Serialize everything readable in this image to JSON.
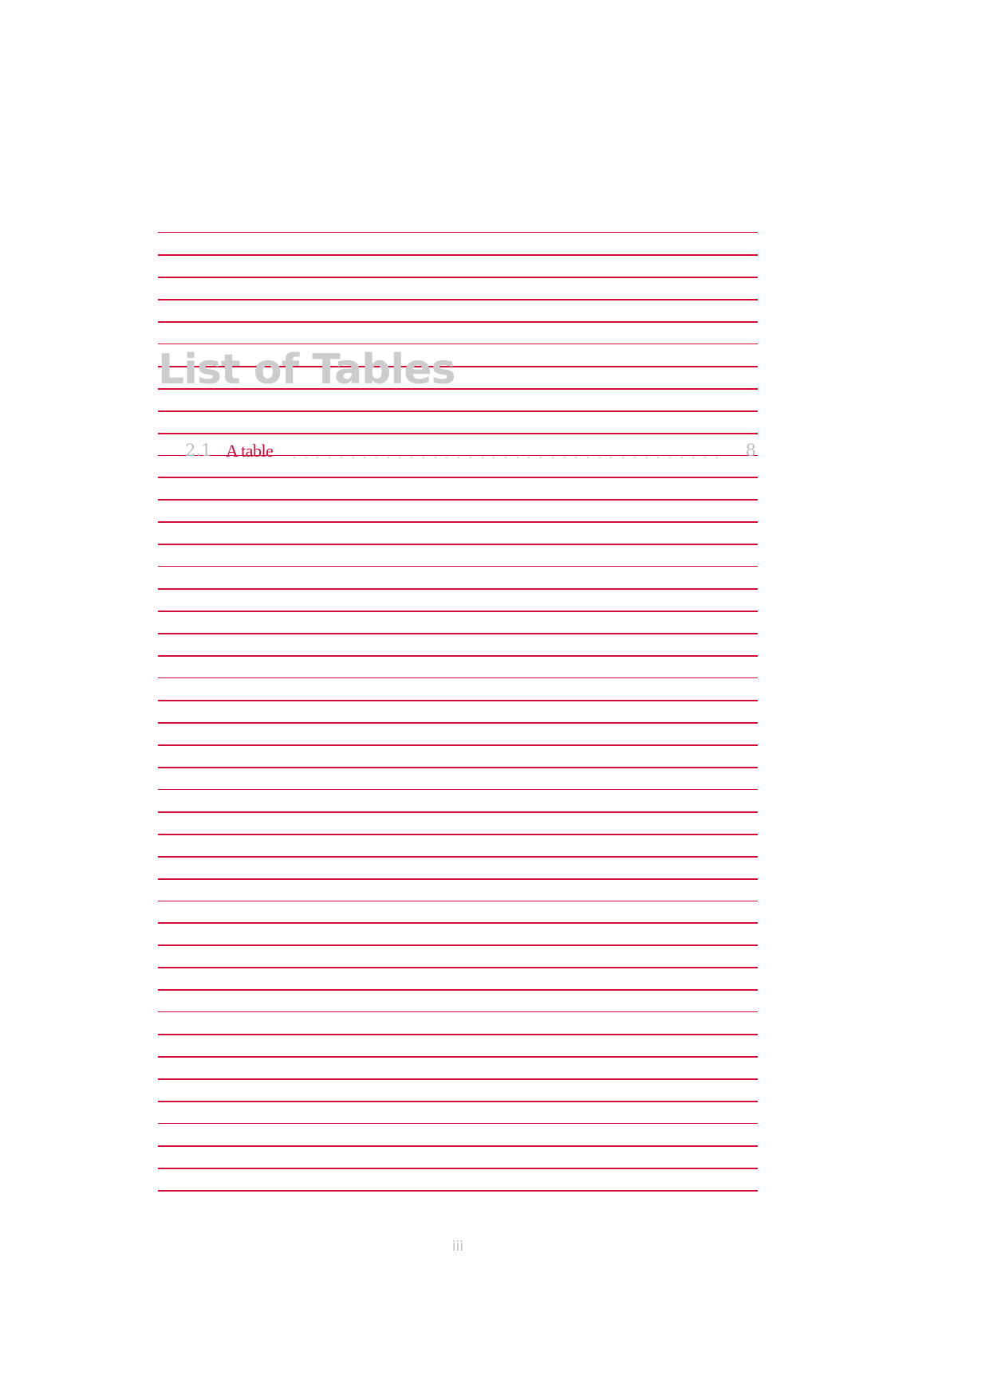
{
  "document": {
    "heading": "List of Tables",
    "entries": [
      {
        "number": "2.1",
        "title": "A table",
        "page": "8"
      }
    ],
    "footer_page_number": "iii"
  },
  "colors": {
    "rule_lines": "#d0103a",
    "heading": "#cccccc",
    "entry_link": "#d0103a",
    "entry_number": "#bdbdbd",
    "footer": "#bbbbbb"
  }
}
